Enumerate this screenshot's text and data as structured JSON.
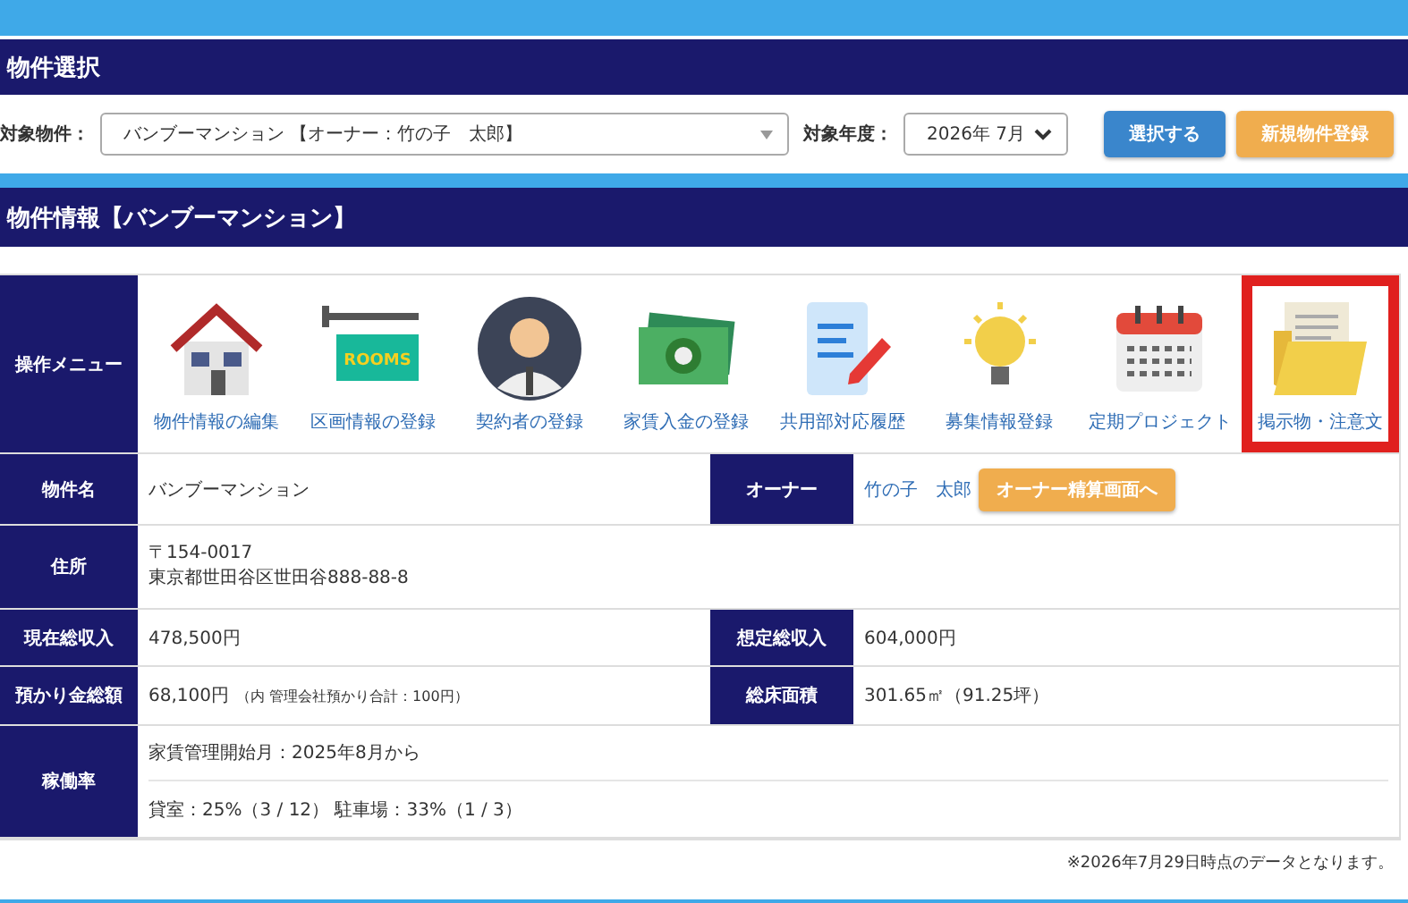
{
  "property_select": {
    "heading": "物件選択",
    "property_label": "対象物件：",
    "property_value": "バンブーマンション 【オーナー：竹の子　太郎】",
    "year_label": "対象年度：",
    "year_value": "2026年 7月",
    "buttons": [
      {
        "label": "選択する",
        "kind": "primary"
      },
      {
        "label": "新規物件登録",
        "kind": "warning"
      }
    ]
  },
  "property_info": {
    "heading": "物件情報【バンブーマンション】",
    "menu_label": "操作メニュー",
    "menu_items": [
      {
        "label": "物件情報の編集",
        "kind": "house",
        "highlighted": false
      },
      {
        "label": "区画情報の登録",
        "kind": "sign",
        "sign_text": "ROOMS",
        "highlighted": false
      },
      {
        "label": "契約者の登録",
        "kind": "person",
        "highlighted": false
      },
      {
        "label": "家賃入金の登録",
        "kind": "money",
        "highlighted": false
      },
      {
        "label": "共用部対応履歴",
        "kind": "document",
        "highlighted": false
      },
      {
        "label": "募集情報登録",
        "kind": "bulb",
        "highlighted": false
      },
      {
        "label": "定期プロジェクト",
        "kind": "calendar",
        "highlighted": false
      },
      {
        "label": "掲示物・注意文",
        "kind": "folder",
        "highlighted": true
      }
    ],
    "name": {
      "label": "物件名",
      "value": "バンブーマンション"
    },
    "owner": {
      "label": "オーナー",
      "link": "竹の子　太郎",
      "button": "オーナー精算画面へ"
    },
    "address": {
      "label": "住所",
      "lines": [
        "〒154-0017",
        "東京都世田谷区世田谷888-88-8"
      ]
    },
    "current_income": {
      "label": "現在総収入",
      "value": "478,500円"
    },
    "expected_income": {
      "label": "想定総収入",
      "value": "604,000円"
    },
    "deposits": {
      "label": "預かり金総額",
      "value": "68,100円",
      "note": "（内 管理会社預かり合計：100円）"
    },
    "floor_area": {
      "label": "総床面積",
      "value": "301.65㎡（91.25坪）"
    },
    "occupancy": {
      "label": "稼働率",
      "lines": [
        "家賃管理開始月：2025年8月から",
        "貸室：25%（3 / 12） 駐車場：33%（1 / 3）"
      ]
    },
    "footnote": "※2026年7月29日時点のデータとなります。"
  }
}
